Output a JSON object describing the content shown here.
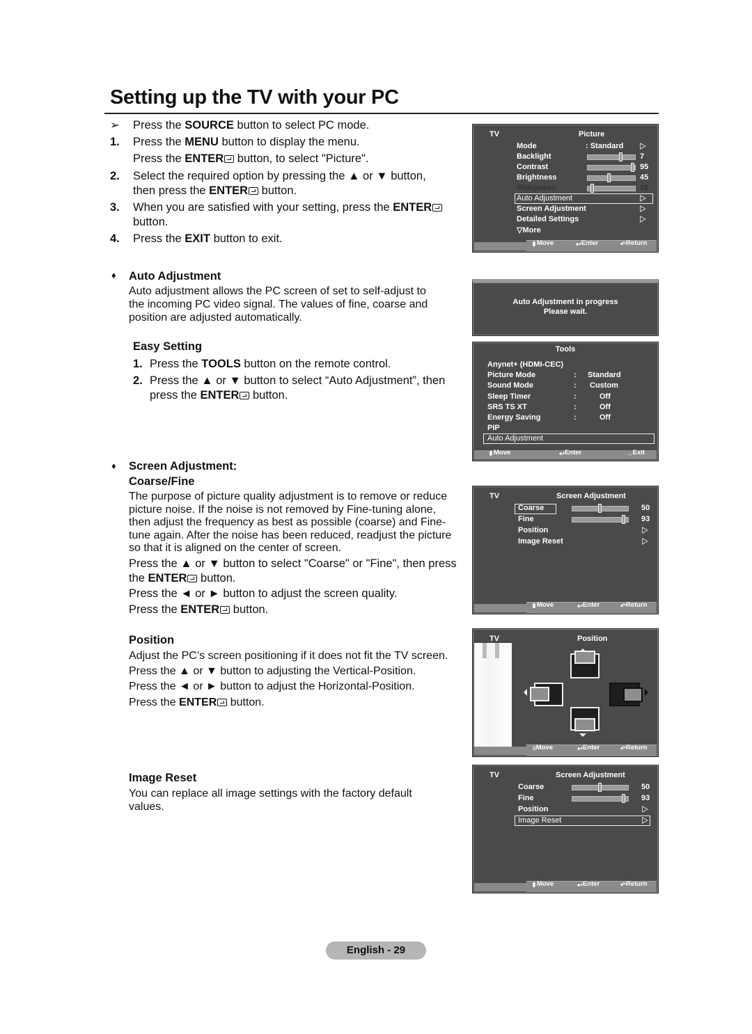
{
  "page": {
    "title": "Setting up the TV with your PC",
    "footer_label": "English - 29"
  },
  "intro": {
    "note_prefix": "Press the ",
    "note_bold": "SOURCE",
    "note_suffix": " button to select PC mode.",
    "steps": [
      {
        "num": "1.",
        "parts": [
          "Press the ",
          "MENU",
          " button to display the menu."
        ]
      },
      {
        "num": "",
        "parts": [
          "Press the ",
          "ENTER",
          " button, to select \"Picture\"."
        ]
      },
      {
        "num": "2.",
        "parts": [
          "Select the required option by pressing the ▲ or ▼ button,"
        ]
      },
      {
        "num": "",
        "parts": [
          "then press the ",
          "ENTER",
          " button."
        ]
      },
      {
        "num": "3.",
        "parts": [
          "When you are satisfied with your setting, press the ",
          "ENTER",
          ""
        ]
      },
      {
        "num": "",
        "parts": [
          "button."
        ]
      },
      {
        "num": "4.",
        "parts": [
          "Press the ",
          "EXIT",
          " button to exit."
        ]
      }
    ]
  },
  "auto_adjustment": {
    "heading": "Auto Adjustment",
    "body": [
      "Auto adjustment allows the PC screen of set to self-adjust to",
      "the incoming PC video signal. The values of fine, coarse and",
      "position are adjusted automatically."
    ],
    "easy_heading": "Easy Setting",
    "easy_steps": [
      {
        "num": "1.",
        "pre": "Press the ",
        "bold": "TOOLS",
        "post": " button on the remote control."
      },
      {
        "num": "2.",
        "pre": "Press the ▲ or ▼ button to select “Auto Adjustment”, then",
        "bold": "",
        "post": ""
      },
      {
        "num": "",
        "pre": "press the ",
        "bold": "ENTER",
        "post": " button."
      }
    ]
  },
  "screen_adjustment": {
    "heading1": "Screen Adjustment:",
    "heading2": "Coarse/Fine",
    "body": [
      "The purpose of picture quality adjustment is to remove or reduce",
      "picture noise. If the noise is not removed by Fine-tuning alone,",
      "then adjust the frequency as best as possible (coarse) and Fine-",
      "tune again. After the noise has been reduced, readjust the picture",
      "so that it is aligned on the center of screen."
    ],
    "line1": "Press the ▲ or ▼ button to select \"Coarse\" or \"Fine\", then press",
    "line2_pre": "the ",
    "line2_bold": "ENTER",
    "line2_post": " button.",
    "line3": "Press the ◄ or ► button to adjust the screen quality.",
    "line4_pre": "Press the ",
    "line4_bold": "ENTER",
    "line4_post": " button."
  },
  "position": {
    "heading": "Position",
    "lines": [
      "Adjust the PC’s screen positioning if it does not fit the TV screen.",
      "Press the ▲ or ▼ button to adjusting the Vertical-Position.",
      "Press the ◄ or ► button to adjust the Horizontal-Position."
    ],
    "enter_pre": "Press the ",
    "enter_bold": "ENTER",
    "enter_post": " button."
  },
  "image_reset": {
    "heading": "Image Reset",
    "body": [
      "You can replace all image settings with the factory default",
      "values."
    ]
  },
  "osd_picture": {
    "tv": "TV",
    "title": "Picture",
    "mode_label": "Mode",
    "mode_value": ": Standard",
    "sliders": [
      {
        "label": "Backlight",
        "value": "7",
        "fraction": 0.7
      },
      {
        "label": "Contrast",
        "value": "95",
        "fraction": 0.95
      },
      {
        "label": "Brightness",
        "value": "45",
        "fraction": 0.45
      },
      {
        "label": "Sharpness",
        "value": "10",
        "fraction": 0.1
      }
    ],
    "items": [
      "Auto Adjustment",
      "Screen Adjustment",
      "Detailed Settings"
    ],
    "more": "▽More",
    "selected": "Auto Adjustment"
  },
  "osd_progress": {
    "line1": "Auto Adjustment in progress",
    "line2": "Please wait."
  },
  "osd_tools": {
    "title": "Tools",
    "rows": [
      {
        "label": "Anynet+ (HDMI-CEC)",
        "sep": "",
        "value": ""
      },
      {
        "label": "Picture Mode",
        "sep": ":",
        "value": "Standard"
      },
      {
        "label": "Sound Mode",
        "sep": ":",
        "value": "Custom"
      },
      {
        "label": "Sleep Timer",
        "sep": ":",
        "value": "Off"
      },
      {
        "label": "SRS TS XT",
        "sep": ":",
        "value": "Off"
      },
      {
        "label": "Energy Saving",
        "sep": ":",
        "value": "Off"
      },
      {
        "label": "PIP",
        "sep": "",
        "value": ""
      }
    ],
    "selected": "Auto Adjustment",
    "footer": {
      "move": "Move",
      "enter": "Enter",
      "exit": "Exit"
    }
  },
  "osd_screen_adj": {
    "tv": "TV",
    "title": "Screen Adjustment",
    "sliders": [
      {
        "label": "Coarse",
        "value": "50",
        "fraction": 0.5
      },
      {
        "label": "Fine",
        "value": "93",
        "fraction": 0.93
      }
    ],
    "items": [
      "Position",
      "Image Reset"
    ]
  },
  "osd_position": {
    "tv": "TV",
    "title": "Position"
  },
  "osd_footer": {
    "move": "Move",
    "enter": "Enter",
    "return": "Return"
  }
}
